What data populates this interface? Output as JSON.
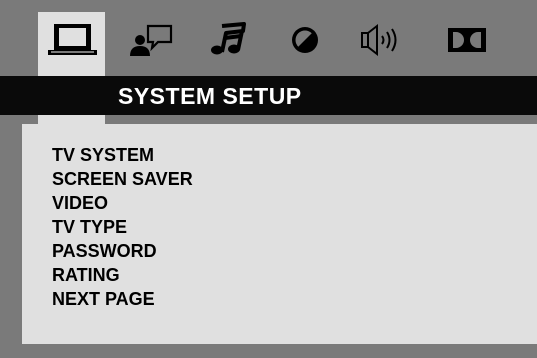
{
  "tabs": [
    {
      "icon": "monitor-icon",
      "active": true
    },
    {
      "icon": "language-speech-icon",
      "active": false
    },
    {
      "icon": "audio-note-icon",
      "active": false
    },
    {
      "icon": "video-brightness-icon",
      "active": false
    },
    {
      "icon": "speaker-icon",
      "active": false
    },
    {
      "icon": "dolby-icon",
      "active": false
    }
  ],
  "header": {
    "title": "SYSTEM SETUP"
  },
  "menu": {
    "items": [
      "TV SYSTEM",
      "SCREEN SAVER",
      "VIDEO",
      "TV TYPE",
      "PASSWORD",
      "RATING",
      "NEXT PAGE"
    ]
  },
  "colors": {
    "background": "#7a7a7a",
    "panel": "#e0e0e0",
    "title_bar": "#0a0a0a",
    "title_text": "#ffffff",
    "menu_text": "#000000"
  }
}
